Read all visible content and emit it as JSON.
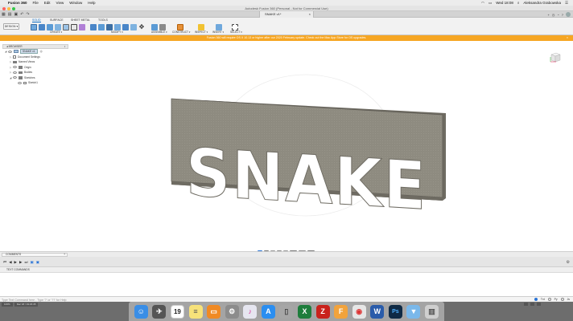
{
  "menubar": {
    "app_name": "Fusion 360",
    "items": [
      "File",
      "Edit",
      "View",
      "Window",
      "Help"
    ],
    "clock": "Wed 18:08",
    "user_name": "Aleksandra Grabowska"
  },
  "window": {
    "title": "Autodesk Fusion 360 (Personal - Not for Commercial Use)"
  },
  "tabs": {
    "document_tab": "SNAKE v1*"
  },
  "ribbon": {
    "workspace": "DESIGN ▾",
    "tabs": [
      "SOLID",
      "SURFACE",
      "SHEET METAL",
      "TOOLS"
    ],
    "groups": [
      "CREATE ▾",
      "MODIFY ▾",
      "ASSEMBLE ▾",
      "CONSTRUCT ▾",
      "INSPECT ▾",
      "INSERT ▾",
      "SELECT ▾"
    ]
  },
  "banner": {
    "text": "Fusion 360 will require OS X 10.13 or higher after our 2020 February update. Check out the Mac App Store for OS upgrades."
  },
  "browser": {
    "title": "BROWSER",
    "root": "SNAKE v1",
    "items": [
      "Document Settings",
      "Named Views",
      "Origin",
      "Bodies",
      "Sketches"
    ],
    "sub_items": [
      "Sketch1"
    ]
  },
  "model": {
    "text": "SNAKE",
    "plate_color": "#8e8b80",
    "plate_side_color": "#6e6b62"
  },
  "comments": {
    "label": "COMMENTS"
  },
  "text_commands": {
    "label": "TEXT COMMANDS",
    "placeholder": "Type Text Command here - Type '?' or '??' for Help",
    "options": [
      "Txt",
      "Py",
      "Js"
    ]
  },
  "status": {
    "zoom": "100%",
    "resolution": "Dec 18 / 19:23:45"
  },
  "dock": {
    "apps": [
      "Finder",
      "Launchpad",
      "Calendar",
      "Notes",
      "iBooks",
      "System Preferences",
      "iTunes",
      "App Store",
      "Keka",
      "Excel",
      "FileZilla",
      "Fusion 360",
      "Chrome",
      "Word",
      "Photoshop",
      "Downloads",
      "Trash"
    ],
    "calendar_day": "19"
  }
}
